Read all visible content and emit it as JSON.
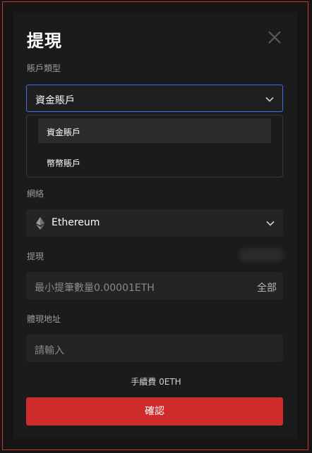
{
  "dialog": {
    "title": "提現",
    "account_type": {
      "label": "賬戶類型",
      "selected": "資金賬戶",
      "options": [
        "資金賬戶",
        "幣幣賬戶"
      ]
    },
    "network": {
      "label": "網絡",
      "selected": "Ethereum",
      "icon": "ethereum-icon"
    },
    "withdraw": {
      "label": "提現",
      "placeholder": "最小提筆數量0.00001ETH",
      "all_label": "全部"
    },
    "address": {
      "label": "體現地址",
      "placeholder": "請輸入"
    },
    "fee_text": "手續費 0ETH",
    "confirm_label": "確認"
  },
  "colors": {
    "accent_red": "#cf2b2b",
    "focus_blue": "#3f6fe3"
  }
}
